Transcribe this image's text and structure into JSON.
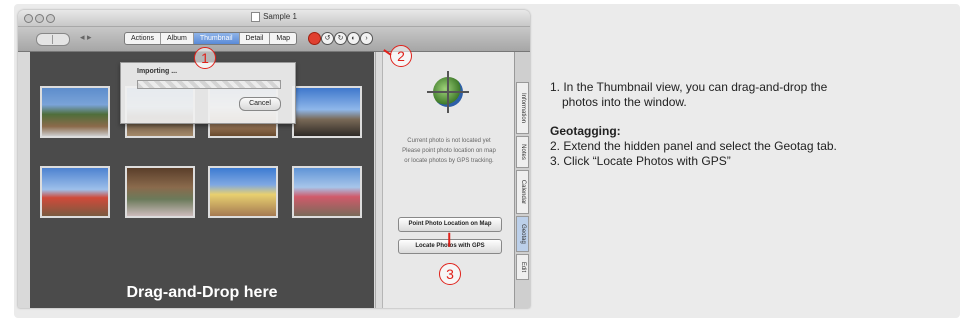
{
  "window": {
    "title": "Sample 1",
    "tabs": [
      "Actions",
      "Album",
      "Thumbnail",
      "Detail",
      "Map"
    ],
    "active_tab": "Thumbnail",
    "toolbar_icons": [
      "record-icon",
      "rotate-left-icon",
      "rotate-right-icon",
      "compass-icon",
      "export-icon"
    ]
  },
  "import_dialog": {
    "label": "Importing ...",
    "cancel_label": "Cancel"
  },
  "browser": {
    "drop_text": "Drag-and-Drop here",
    "thumbnail_count": 8
  },
  "geo_panel": {
    "status_line1": "Current photo is not located yet",
    "status_line2": "Please point photo location on map",
    "status_line3": "or locate photos by GPS tracking.",
    "point_button": "Point Photo Location on Map",
    "locate_button": "Locate Photos with GPS"
  },
  "side_tabs": [
    "Information",
    "Notes",
    "Calendar",
    "Geotag",
    "Edit"
  ],
  "active_side_tab": "Geotag",
  "callouts": [
    "1",
    "2",
    "3"
  ],
  "callout_color": "#e0211a",
  "instructions": {
    "step1_line1": "1. In the Thumbnail view, you can drag-and-drop the",
    "step1_line2": "photos into the window.",
    "geotag_heading": "Geotagging:",
    "step2": "2. Extend the hidden panel and select the Geotag tab.",
    "step3": "3. Click “Locate Photos with GPS”"
  }
}
